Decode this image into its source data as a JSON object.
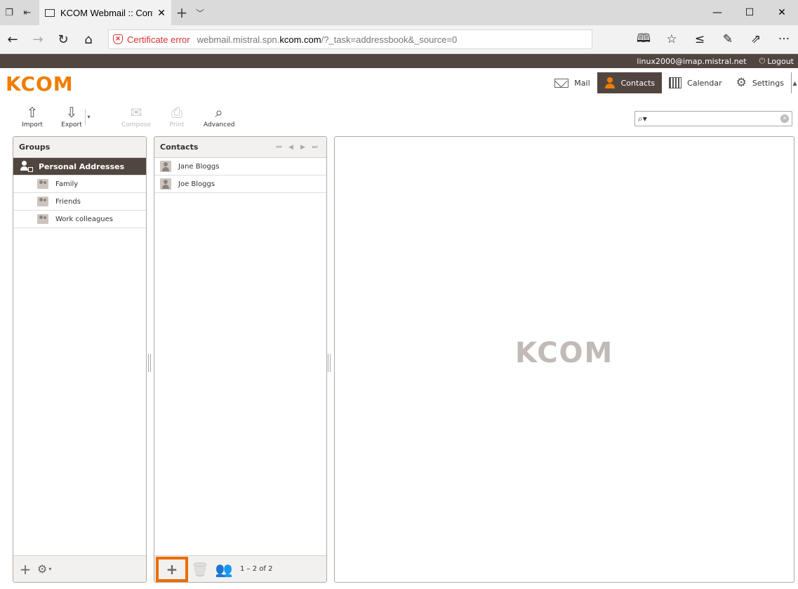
{
  "browser": {
    "tab_title": "KCOM Webmail :: Conta",
    "cert_error": "Certificate error",
    "url_prefix": "webmail.mistral.spn.",
    "url_strong": "kcom.com",
    "url_suffix": "/?_task=addressbook&_source=0"
  },
  "topline": {
    "user": "linux2000@imap.mistral.net",
    "logout": "Logout"
  },
  "header": {
    "logo": "KCOM",
    "tabs": {
      "mail": "Mail",
      "contacts": "Contacts",
      "calendar": "Calendar",
      "settings": "Settings"
    }
  },
  "toolbar": {
    "import": "Import",
    "export": "Export",
    "compose": "Compose",
    "print": "Print",
    "advanced": "Advanced",
    "search_value": ""
  },
  "groups": {
    "title": "Groups",
    "items": [
      "Personal Addresses",
      "Family",
      "Friends",
      "Work colleagues"
    ]
  },
  "contacts": {
    "title": "Contacts",
    "items": [
      "Jane Bloggs",
      "Joe Bloggs"
    ],
    "count": "1 – 2 of 2"
  },
  "preview": {
    "watermark": "KCOM"
  },
  "colors": {
    "brand_orange": "#f07d00",
    "dark_brown": "#514540",
    "highlight": "#ec6d00"
  }
}
